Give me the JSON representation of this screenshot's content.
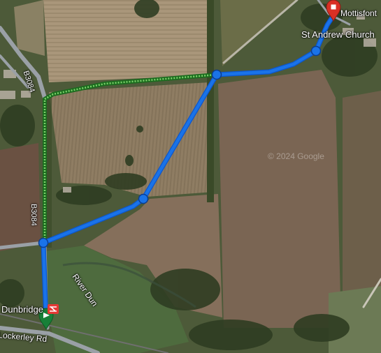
{
  "map": {
    "copyright": "© 2024 Google",
    "places": {
      "destination": "Mottisfont",
      "church": "St Andrew Church",
      "station": "Dunbridge",
      "river": "River Dun",
      "lane": "Lockerley Rd"
    },
    "roads": {
      "b_road": "B3084",
      "b_road_south": "B3084"
    },
    "markers": {
      "start": "start-pin-icon",
      "end": "destination-pin-icon",
      "rail": "national-rail-icon"
    },
    "colors": {
      "route": "#1a73e8",
      "route_alt": "#7bd16a",
      "start_pin": "#188038",
      "end_pin": "#d93025",
      "rail_logo": "#e53935"
    }
  }
}
